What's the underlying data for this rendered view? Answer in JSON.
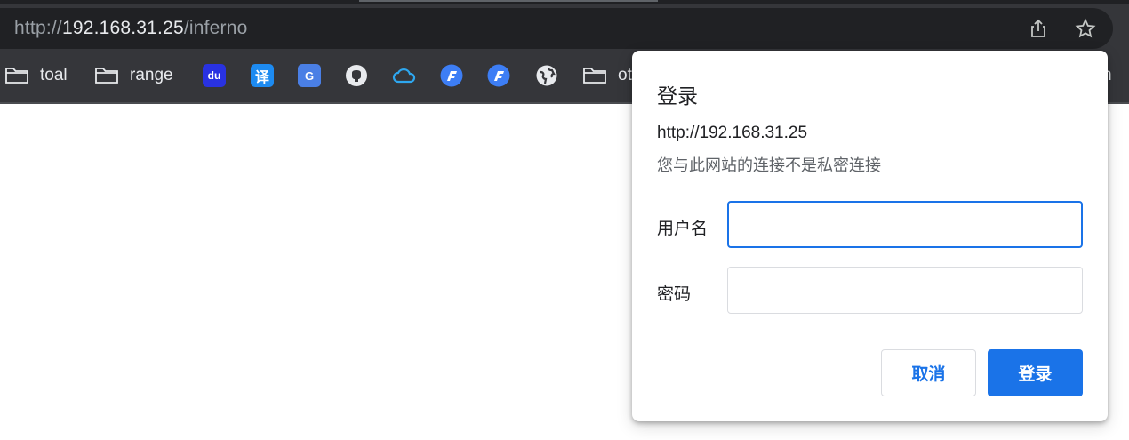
{
  "omnibox": {
    "url_scheme": "http://",
    "url_host": "192.168.31.25",
    "url_path": "/inferno",
    "share_icon": "share-icon",
    "star_icon": "star-icon"
  },
  "bookmarks": [
    {
      "label": "toal",
      "icon": "folder-icon"
    },
    {
      "label": "range",
      "icon": "folder-icon"
    },
    {
      "label": "",
      "icon": "baidu-icon"
    },
    {
      "label": "",
      "icon": "translate-icon"
    },
    {
      "label": "",
      "icon": "google-translate-icon"
    },
    {
      "label": "",
      "icon": "github-icon"
    },
    {
      "label": "",
      "icon": "cloud-icon"
    },
    {
      "label": "",
      "icon": "app-icon"
    },
    {
      "label": "",
      "icon": "app-icon"
    },
    {
      "label": "",
      "icon": "globe-icon"
    },
    {
      "label": "ot",
      "icon": "folder-icon"
    }
  ],
  "bookmark_glyphs": {
    "baidu": "du",
    "translate": "译",
    "google_translate": "G",
    "overflow_tail": "n"
  },
  "dialog": {
    "title": "登录",
    "host": "http://192.168.31.25",
    "warning": "您与此网站的连接不是私密连接",
    "username_label": "用户名",
    "username_value": "",
    "password_label": "密码",
    "password_value": "",
    "cancel_label": "取消",
    "login_label": "登录"
  },
  "colors": {
    "accent": "#1a73e8",
    "toolbar_bg": "#35363a",
    "omnibox_bg": "#202124"
  }
}
